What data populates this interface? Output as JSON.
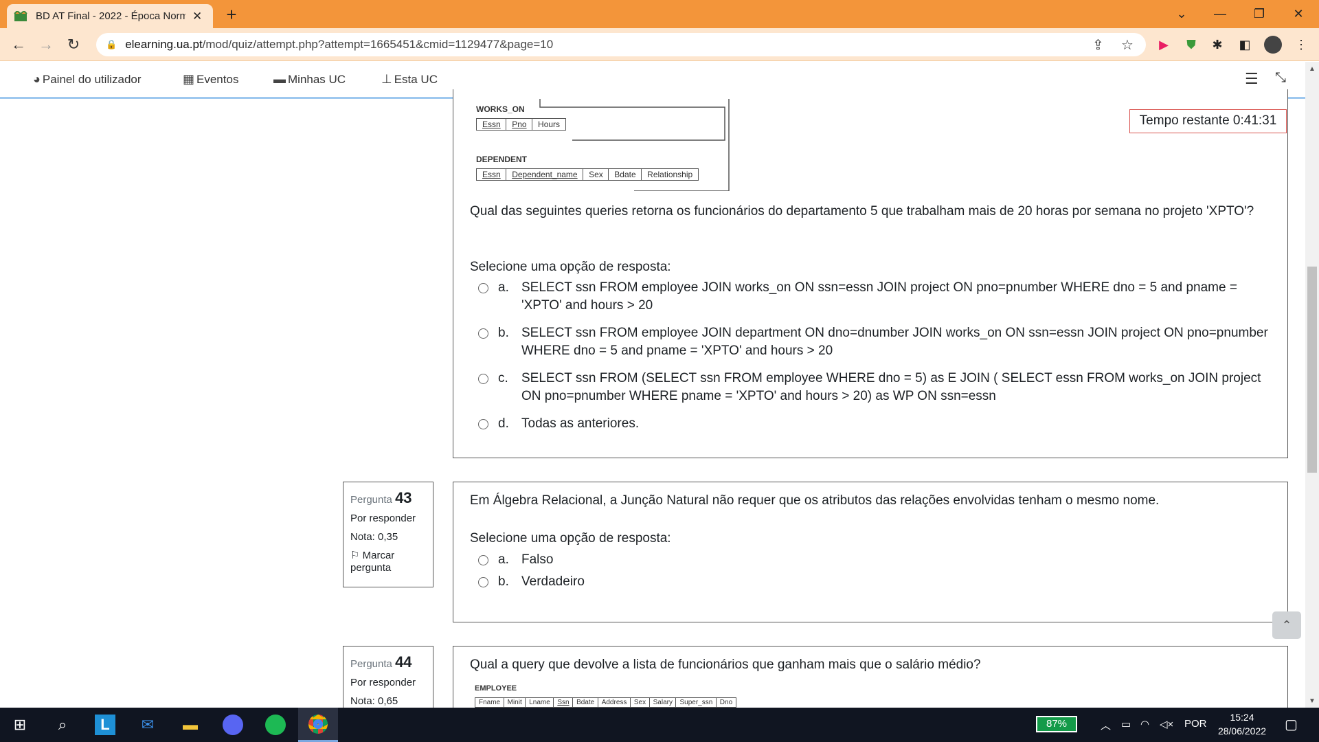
{
  "browser": {
    "tab_title": "BD AT Final - 2022 - Época Norm",
    "url_prefix": "elearning.ua.pt",
    "url_rest": "/mod/quiz/attempt.php?attempt=1665451&cmid=1129477&page=10"
  },
  "nav": {
    "items": [
      {
        "label": "Painel do utilizador",
        "icon": "dashboard-icon"
      },
      {
        "label": "Eventos",
        "icon": "calendar-icon"
      },
      {
        "label": "Minhas UC",
        "icon": "briefcase-icon"
      },
      {
        "label": "Esta UC",
        "icon": "sitemap-icon"
      }
    ]
  },
  "timer": "Tempo restante 0:41:31",
  "schema_top": {
    "works_on_label": "WORKS_ON",
    "works_on_cols": [
      "Essn",
      "Pno",
      "Hours"
    ],
    "dependent_label": "DEPENDENT",
    "dependent_cols": [
      "Essn",
      "Dependent_name",
      "Sex",
      "Bdate",
      "Relationship"
    ]
  },
  "q42": {
    "text": "Qual das seguintes queries retorna os funcionários do departamento 5 que trabalham mais de 20 horas por semana no projeto 'XPTO'?",
    "prompt": "Selecione uma opção de resposta:",
    "options": [
      {
        "letter": "a.",
        "text": "SELECT ssn FROM employee JOIN works_on ON ssn=essn JOIN project ON pno=pnumber WHERE dno = 5 and pname = 'XPTO' and hours > 20"
      },
      {
        "letter": "b.",
        "text": "SELECT ssn FROM employee JOIN department ON dno=dnumber JOIN works_on ON ssn=essn JOIN project ON pno=pnumber WHERE dno = 5 and pname = 'XPTO' and hours > 20"
      },
      {
        "letter": "c.",
        "text": "SELECT ssn FROM (SELECT ssn FROM employee WHERE dno = 5) as E JOIN ( SELECT essn FROM works_on JOIN project ON pno=pnumber WHERE pname = 'XPTO' and hours > 20) as WP ON ssn=essn"
      },
      {
        "letter": "d.",
        "text": "Todas as anteriores."
      }
    ]
  },
  "q43": {
    "label": "Pergunta",
    "number": "43",
    "status": "Por responder",
    "grade": "Nota: 0,35",
    "flag": "Marcar pergunta",
    "text": "Em Álgebra Relacional, a Junção Natural não requer que os atributos das relações envolvidas tenham o mesmo nome.",
    "prompt": "Selecione uma opção de resposta:",
    "options": [
      {
        "letter": "a.",
        "text": "Falso"
      },
      {
        "letter": "b.",
        "text": "Verdadeiro"
      }
    ]
  },
  "q44": {
    "label": "Pergunta",
    "number": "44",
    "status": "Por responder",
    "grade": "Nota: 0,65",
    "text": "Qual a query que devolve a lista de funcionários que ganham mais que o salário médio?",
    "employee_label": "EMPLOYEE",
    "employee_cols": [
      "Fname",
      "Minit",
      "Lname",
      "Ssn",
      "Bdate",
      "Address",
      "Sex",
      "Salary",
      "Super_ssn",
      "Dno"
    ]
  },
  "taskbar": {
    "battery": "87%",
    "lang": "POR",
    "time": "15:24",
    "date": "28/06/2022"
  }
}
